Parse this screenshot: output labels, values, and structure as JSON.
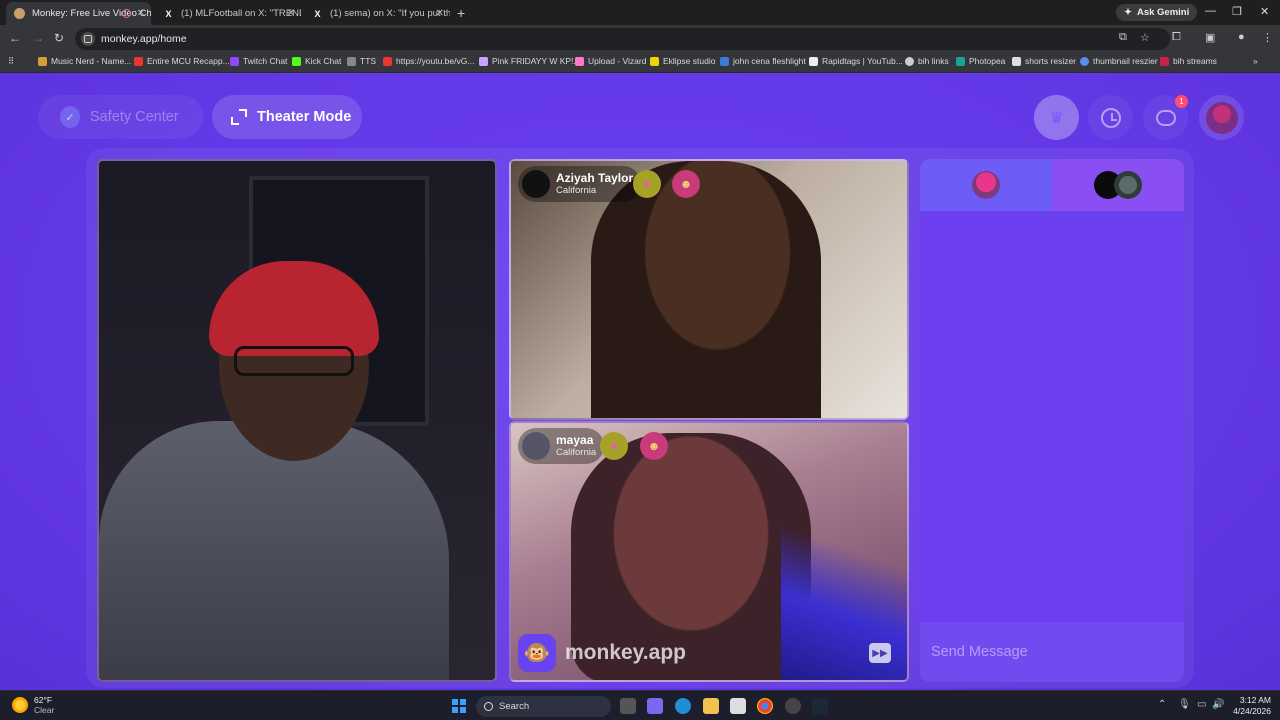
{
  "browser": {
    "tabs": [
      {
        "title": "Monkey: Free Live Video Ch",
        "active": true
      },
      {
        "title": "(1) MLFootball on X: \"TRENDIN",
        "active": false
      },
      {
        "title": "(1) sema) on X: \"If you put this",
        "active": false
      }
    ],
    "new_tab": "+",
    "gemini": "Ask Gemini",
    "url": "monkey.app/home",
    "bookmarks": [
      "Music Nerd - Name...",
      "Entire MCU Recapp...",
      "Twitch Chat",
      "Kick Chat",
      "TTS",
      "https://youtu.be/vG...",
      "Pink FRIDAYY W KP!...",
      "Upload - Vizard",
      "Eklipse studio",
      "john cena fleshlight",
      "Rapidtags | YouTub...",
      "bih links",
      "Photopea",
      "shorts resizer",
      "thumbnail reszier",
      "bih streams"
    ]
  },
  "app": {
    "safety_center": "Safety Center",
    "theater_mode": "Theater Mode",
    "message_badge": "1",
    "users": [
      {
        "name": "Aziyah Taylor",
        "location": "California"
      },
      {
        "name": "mayaa",
        "location": "California"
      }
    ],
    "watermark": "monkey.app",
    "chat_placeholder": "Send Message",
    "colors": {
      "background": "#6338e6",
      "accent": "#6d5cf5"
    }
  },
  "taskbar": {
    "temperature": "62°F",
    "condition": "Clear",
    "search": "Search",
    "time": "3:12 AM",
    "date": "4/24/2026"
  }
}
